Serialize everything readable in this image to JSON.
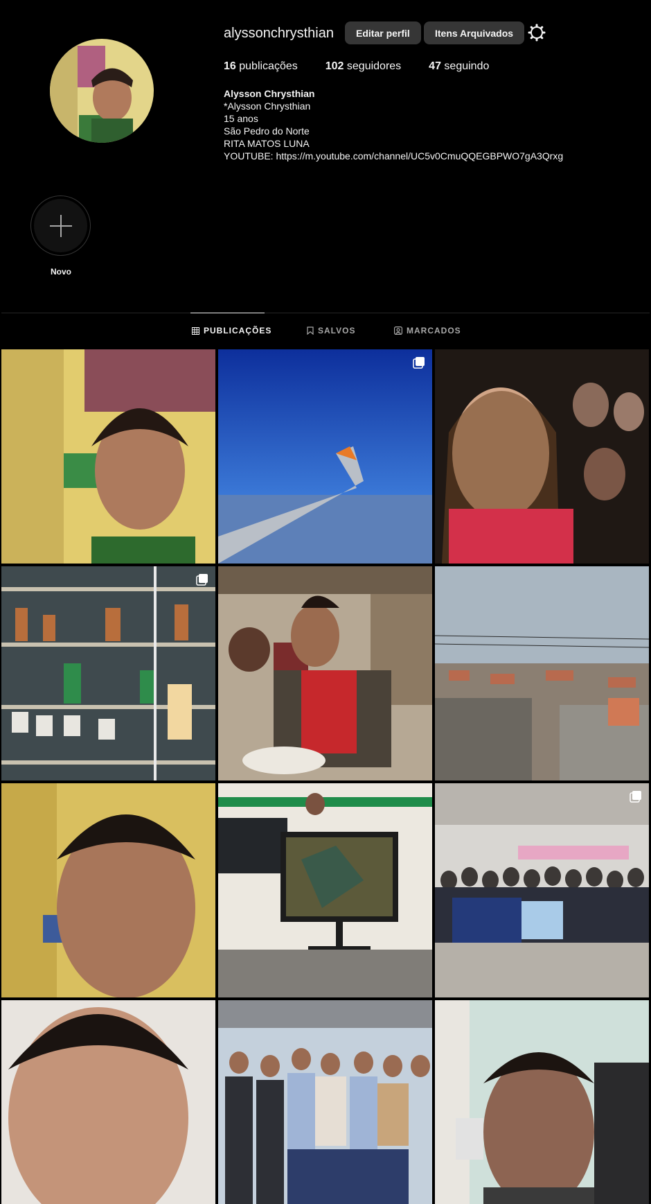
{
  "profile": {
    "username": "alyssonchrysthian",
    "edit_label": "Editar perfil",
    "archived_label": "Itens Arquivados",
    "settings_icon": "settings-icon",
    "stats": [
      {
        "count": "16",
        "label": " publicações"
      },
      {
        "count": "102",
        "label": " seguidores"
      },
      {
        "count": "47",
        "label": " seguindo"
      }
    ],
    "bio": {
      "name": "Alysson Chrysthian",
      "lines": [
        "*Alysson Chrysthian",
        "15 anos",
        "São Pedro do Norte",
        "RITA MATOS LUNA",
        "YOUTUBE: https://m.youtube.com/channel/UC5v0CmuQQEGBPWO7gA3Qrxg"
      ]
    }
  },
  "highlights": {
    "new_label": "Novo",
    "icon": "plus-icon"
  },
  "tabs": [
    {
      "label": "PUBLICAÇÕES",
      "icon": "grid-icon",
      "active": true
    },
    {
      "label": "SALVOS",
      "icon": "bookmark-icon",
      "active": false
    },
    {
      "label": "MARCADOS",
      "icon": "tagged-icon",
      "active": false
    }
  ],
  "posts": [
    {
      "subject": "selfie",
      "multi": false
    },
    {
      "subject": "airplane-wing",
      "multi": true
    },
    {
      "subject": "group-selfie",
      "multi": false
    },
    {
      "subject": "toy-shelf",
      "multi": true
    },
    {
      "subject": "restaurant",
      "multi": false
    },
    {
      "subject": "city-view",
      "multi": false
    },
    {
      "subject": "selfie-closeup",
      "multi": false
    },
    {
      "subject": "game-monitor",
      "multi": false
    },
    {
      "subject": "class-photo",
      "multi": true
    },
    {
      "subject": "selfie-light",
      "multi": false
    },
    {
      "subject": "award-group",
      "multi": false
    },
    {
      "subject": "selfie-chair",
      "multi": false
    }
  ],
  "colors": {
    "background": "#000000",
    "button": "#363636",
    "muted": "#a8a8a8",
    "divider": "#262626"
  }
}
